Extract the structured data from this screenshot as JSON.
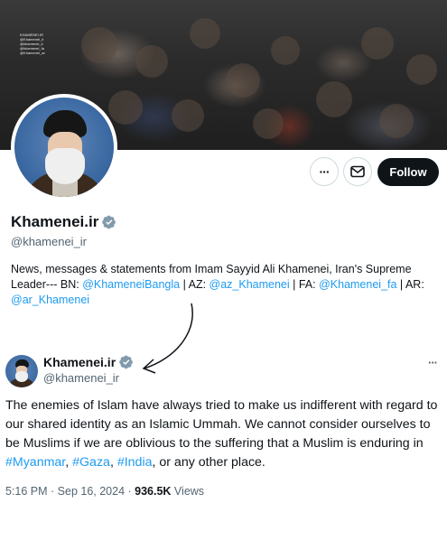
{
  "banner": {
    "badge_lines": [
      "KHAMENEI.IR",
      "@Khamenei_ir",
      "@khamenei_ir",
      "@khamenei_fa",
      "@Khamenei_ar",
      "khamenei.ir"
    ]
  },
  "profile": {
    "name": "Khamenei.ir",
    "handle": "@khamenei_ir",
    "follow_label": "Follow",
    "more_label": "···",
    "bio": {
      "text1": "News, messages & statements from Imam Sayyid Ali Khamenei, Iran's Supreme Leader--- BN: ",
      "link1": "@KhameneiBangla",
      "sep1": " | AZ: ",
      "link2": "@az_Khamenei",
      "sep2": " | FA: ",
      "link3": "@Khamenei_fa",
      "sep3": " | AR: ",
      "link4": "@ar_Khamenei"
    }
  },
  "tweet": {
    "name": "Khamenei.ir",
    "handle": "@khamenei_ir",
    "more_label": "···",
    "text1": "The enemies of Islam have always tried to make us indifferent with regard to our shared identity as an Islamic Ummah. We cannot consider ourselves to be Muslims if we are oblivious to the suffering that a Muslim is enduring in ",
    "tag1": "#Myanmar",
    "sep1": ", ",
    "tag2": "#Gaza",
    "sep2": ", ",
    "tag3": "#India",
    "text2": ", or any other place.",
    "time": "5:16 PM · Sep 16, 2024 · ",
    "views_count": "936.5K",
    "views_label": " Views"
  },
  "colors": {
    "link": "#1d9bf0",
    "verified": "#829aab",
    "follow_bg": "#0f1419",
    "secondary_text": "#536471"
  },
  "icons": [
    "more-icon",
    "mail-icon",
    "verified-badge-icon",
    "arrow-annotation-icon"
  ]
}
